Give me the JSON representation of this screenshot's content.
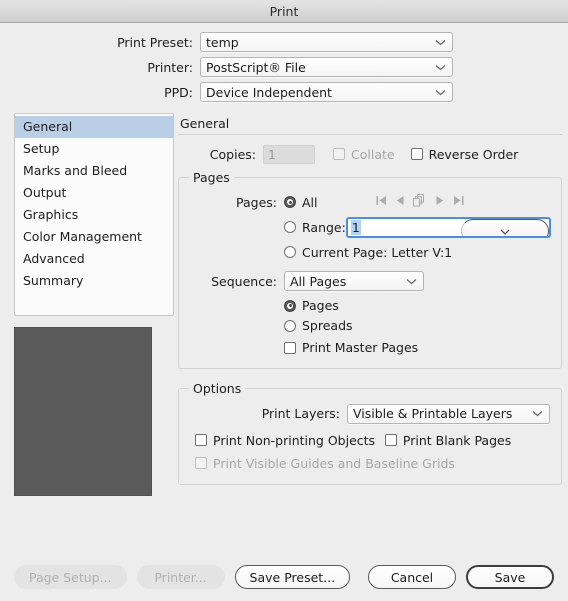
{
  "window": {
    "title": "Print"
  },
  "top": {
    "rows": [
      {
        "label": "Print Preset:",
        "value": "temp",
        "name": "print-preset"
      },
      {
        "label": "Printer:",
        "value": "PostScript® File",
        "name": "printer"
      },
      {
        "label": "PPD:",
        "value": "Device Independent",
        "name": "ppd"
      }
    ]
  },
  "sidebar": {
    "items": [
      {
        "label": "General",
        "selected": true
      },
      {
        "label": "Setup",
        "selected": false
      },
      {
        "label": "Marks and Bleed",
        "selected": false
      },
      {
        "label": "Output",
        "selected": false
      },
      {
        "label": "Graphics",
        "selected": false
      },
      {
        "label": "Color Management",
        "selected": false
      },
      {
        "label": "Advanced",
        "selected": false
      },
      {
        "label": "Summary",
        "selected": false
      }
    ]
  },
  "panel": {
    "title": "General",
    "copies": {
      "label": "Copies:",
      "value": "1",
      "collate_label": "Collate",
      "collate_checked": false,
      "collate_disabled": true,
      "reverse_label": "Reverse Order",
      "reverse_checked": false
    },
    "pages_group": {
      "legend": "Pages",
      "pages_label": "Pages:",
      "all_label": "All",
      "all_selected": true,
      "range_label": "Range:",
      "range_selected": false,
      "range_value": "1",
      "current_label": "Current Page: Letter V:1",
      "current_selected": false,
      "nav_icons": [
        "first-page-icon",
        "previous-page-icon",
        "spreads-icon",
        "next-page-icon",
        "last-page-icon"
      ],
      "sequence_label": "Sequence:",
      "sequence_value": "All Pages",
      "pages_radio_label": "Pages",
      "pages_radio_selected": true,
      "spreads_radio_label": "Spreads",
      "spreads_radio_selected": false,
      "master_label": "Print Master Pages",
      "master_checked": false
    },
    "options_group": {
      "legend": "Options",
      "layers_label": "Print Layers:",
      "layers_value": "Visible & Printable Layers",
      "checkboxes": [
        {
          "label": "Print Non-printing Objects",
          "checked": false,
          "disabled": false
        },
        {
          "label": "Print Blank Pages",
          "checked": false,
          "disabled": false
        },
        {
          "label": "Print Visible Guides and Baseline Grids",
          "checked": false,
          "disabled": true
        }
      ]
    }
  },
  "footer": {
    "page_setup": "Page Setup...",
    "printer": "Printer...",
    "save_preset": "Save Preset...",
    "cancel": "Cancel",
    "save": "Save"
  },
  "colors": {
    "window_bg": "#ededed",
    "selection_blue": "#b9cfe8",
    "focus_blue": "#4a90e2",
    "text_selection": "#b0d3f7",
    "preview_gray": "#5a5a5a"
  }
}
